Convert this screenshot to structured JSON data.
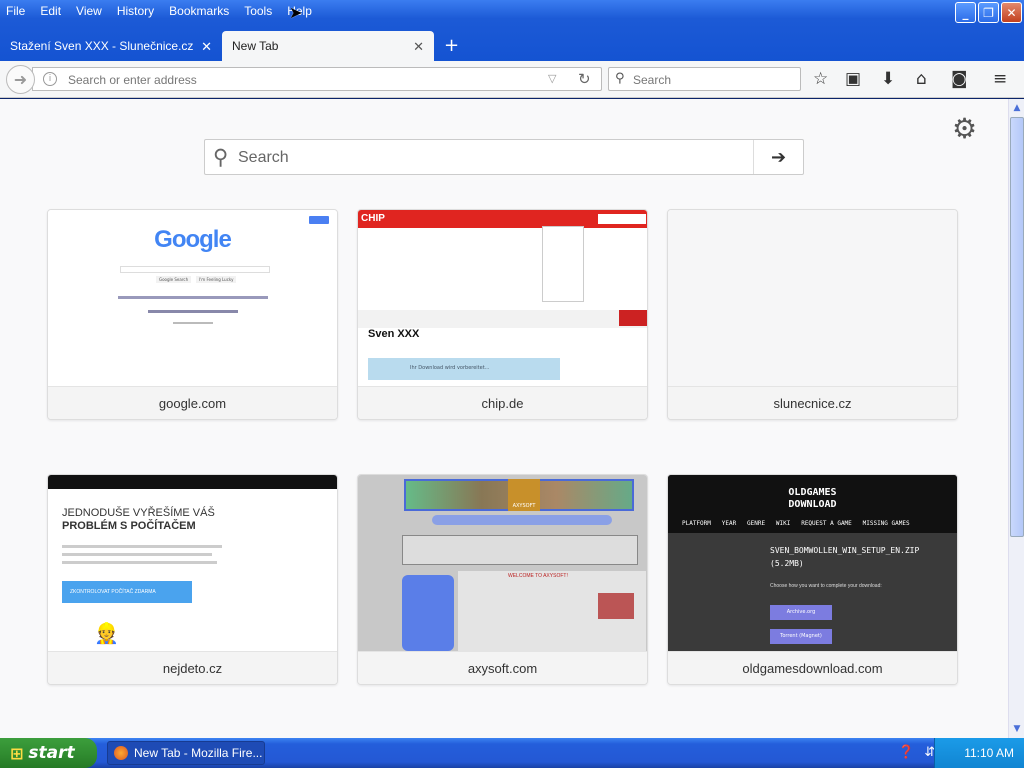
{
  "menu": [
    "File",
    "Edit",
    "View",
    "History",
    "Bookmarks",
    "Tools",
    "Help"
  ],
  "tabs": [
    {
      "title": "Stažení Sven XXX - Slunečnice.cz"
    },
    {
      "title": "New Tab"
    }
  ],
  "url": {
    "placeholder": "Search or enter address"
  },
  "search": {
    "placeholder": "Search"
  },
  "newtab": {
    "search_placeholder": "Search",
    "tiles": [
      {
        "label": "google.com"
      },
      {
        "label": "chip.de"
      },
      {
        "label": "slunecnice.cz"
      },
      {
        "label": "nejdeto.cz"
      },
      {
        "label": "axysoft.com"
      },
      {
        "label": "oldgamesdownload.com"
      }
    ],
    "thumbs": {
      "google": {
        "logo": "Google",
        "btn1": "Google Search",
        "btn2": "I'm Feeling Lucky"
      },
      "chip": {
        "logo": "CHIP",
        "heading": "Sven XXX",
        "notice": "Ihr Download wird vorbereitet..."
      },
      "nejdeto": {
        "line1": "JEDNODUŠE VYŘEŠÍME VÁŠ",
        "line2": "PROBLÉM S POČÍTAČEM",
        "button": "ZKONTROLOVAT POČÍTAČ ZDARMA"
      },
      "axysoft": {
        "welcome": "WELCOME TO AXYSOFT!",
        "brand": "AXYSOFT"
      },
      "oldgames": {
        "logo1": "OLDGAMES",
        "logo2": "DOWNLOAD",
        "nav": "PLATFORM   YEAR   GENRE   WIKI   REQUEST A GAME   MISSING GAMES",
        "file": "SVEN_BOMWOLLEN_WIN_SETUP_EN.ZIP",
        "size": "(5.2MB)",
        "choose": "Choose how you want to complete your download:",
        "btn1": "Archive.org",
        "btn2": "Torrent (Magnet)"
      }
    }
  },
  "taskbar": {
    "start": "start",
    "item": "New Tab - Mozilla Fire...",
    "clock": "11:10 AM"
  }
}
